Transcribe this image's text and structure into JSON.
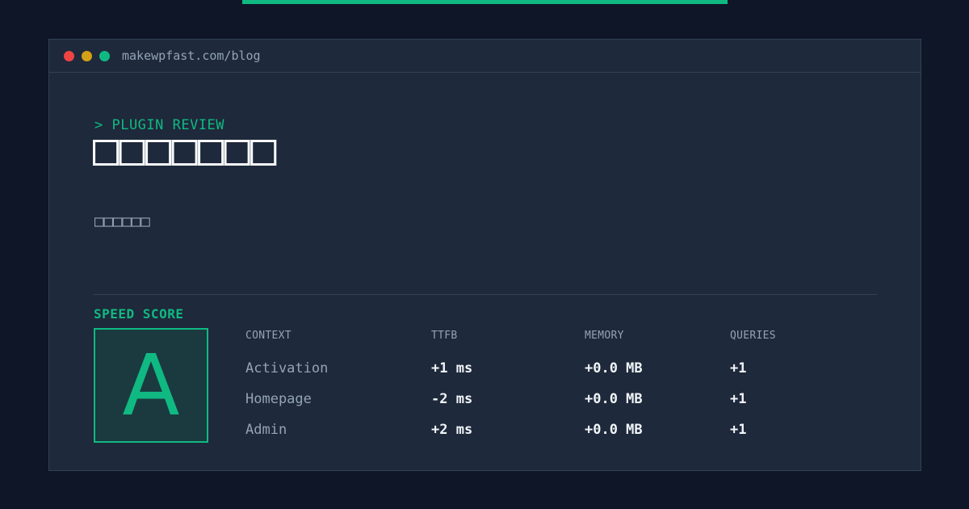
{
  "window": {
    "url": "makewpfast.com/blog"
  },
  "article": {
    "kicker": "> PLUGIN REVIEW",
    "title": "□□□□□□□",
    "subtitle": "□□□□□□"
  },
  "score": {
    "label": "SPEED SCORE",
    "grade": "A"
  },
  "metrics": {
    "headers": [
      "CONTEXT",
      "TTFB",
      "MEMORY",
      "QUERIES"
    ],
    "rows": [
      {
        "context": "Activation",
        "ttfb": "+1 ms",
        "memory": "+0.0 MB",
        "queries": "+1"
      },
      {
        "context": "Homepage",
        "ttfb": "-2 ms",
        "memory": "+0.0 MB",
        "queries": "+1"
      },
      {
        "context": "Admin",
        "ttfb": "+2 ms",
        "memory": "+0.0 MB",
        "queries": "+1"
      }
    ]
  },
  "colors": {
    "accent": "#10b981",
    "background": "#0e1628",
    "panel": "#1e293b"
  }
}
